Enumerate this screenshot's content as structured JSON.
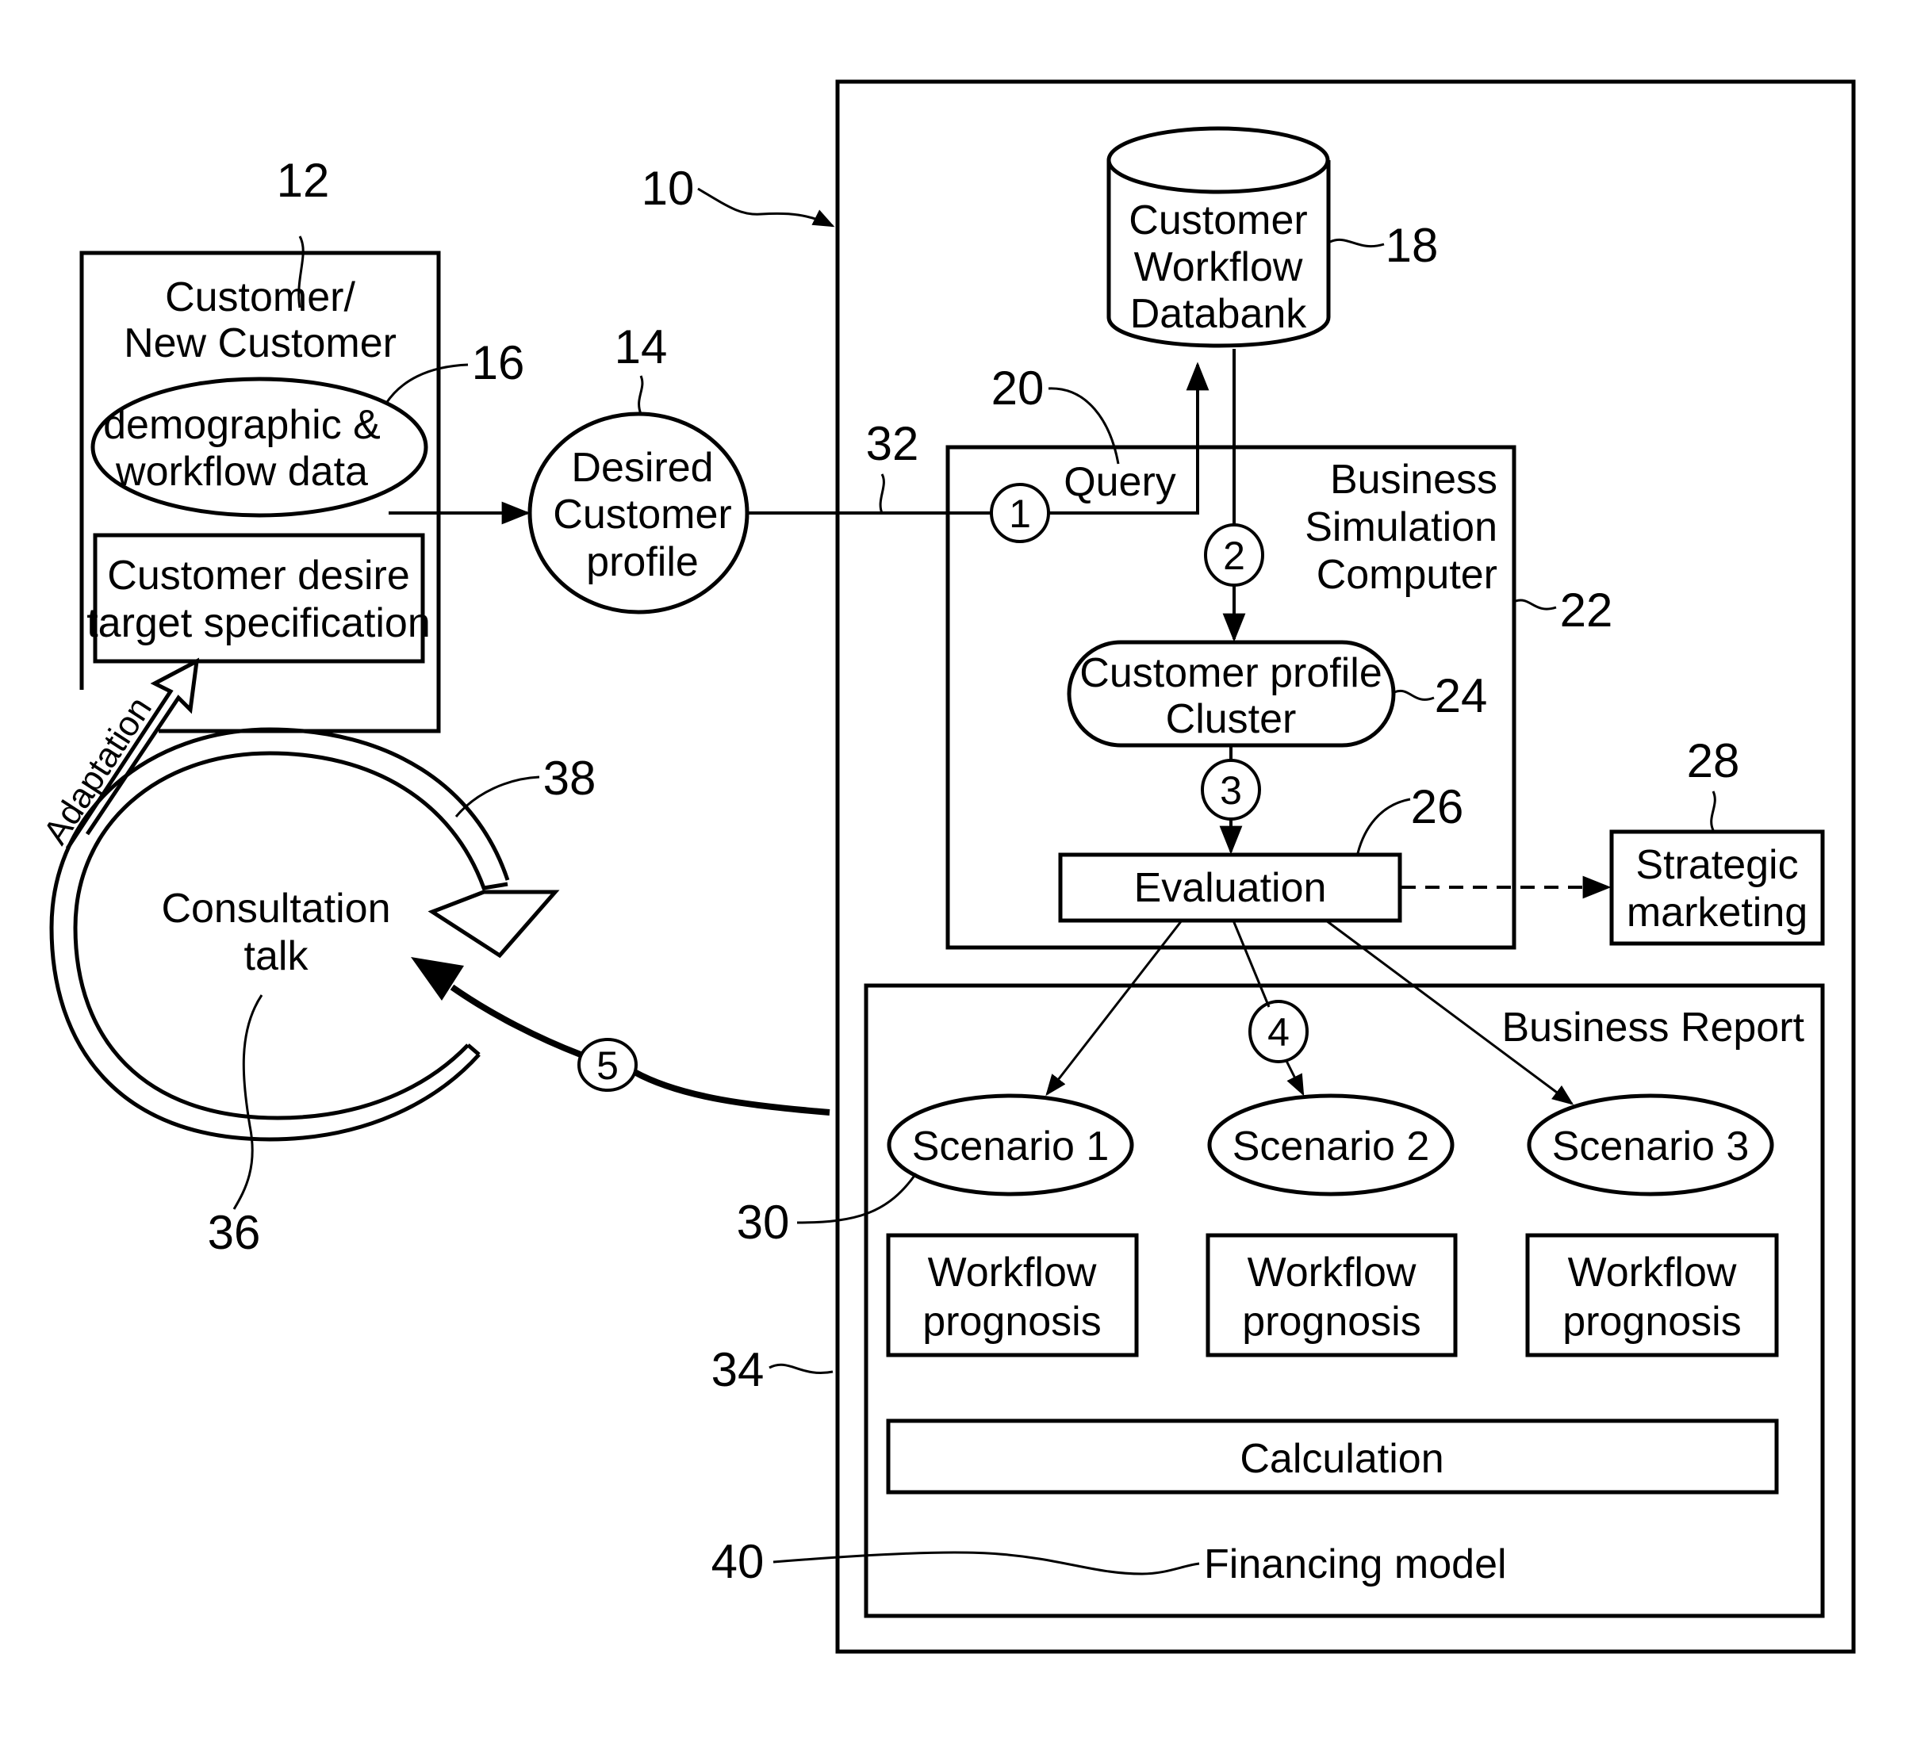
{
  "diagram": {
    "type": "patent-block-diagram",
    "customer_block": {
      "ref": "12",
      "title_line1": "Customer/",
      "title_line2": "New Customer",
      "data_ellipse": {
        "ref": "16",
        "line1": "demographic &",
        "line2": "workflow data"
      },
      "desire_box": {
        "line1": "Customer desire",
        "line2": "target specification"
      }
    },
    "desired_profile": {
      "ref": "14",
      "line1": "Desired",
      "line2": "Customer",
      "line3": "profile"
    },
    "system": {
      "ref": "10"
    },
    "databank": {
      "ref": "18",
      "line1": "Customer",
      "line2": "Workflow",
      "line3": "Databank"
    },
    "query": {
      "ref": "20",
      "label": "Query"
    },
    "link_ref": "32",
    "simulation_computer": {
      "ref": "22",
      "line1": "Business",
      "line2": "Simulation",
      "line3": "Computer"
    },
    "cluster": {
      "ref": "24",
      "line1": "Customer profile",
      "line2": "Cluster"
    },
    "evaluation": {
      "ref": "26",
      "label": "Evaluation"
    },
    "strategic_marketing": {
      "ref": "28",
      "line1": "Strategic",
      "line2": "marketing"
    },
    "steps": [
      "1",
      "2",
      "3",
      "4",
      "5"
    ],
    "business_report": {
      "ref": "34",
      "title": "Business Report",
      "scenario_ref": "30",
      "scenarios": [
        "Scenario 1",
        "Scenario 2",
        "Scenario 3"
      ],
      "prognosis_line1": "Workflow",
      "prognosis_line2": "prognosis",
      "calculation": "Calculation",
      "financing": {
        "ref": "40",
        "label": "Financing model"
      }
    },
    "consultation": {
      "ref": "36",
      "line1": "Consultation",
      "line2": "talk",
      "cycle_ref": "38"
    },
    "adaptation_label": "Adaptation"
  }
}
